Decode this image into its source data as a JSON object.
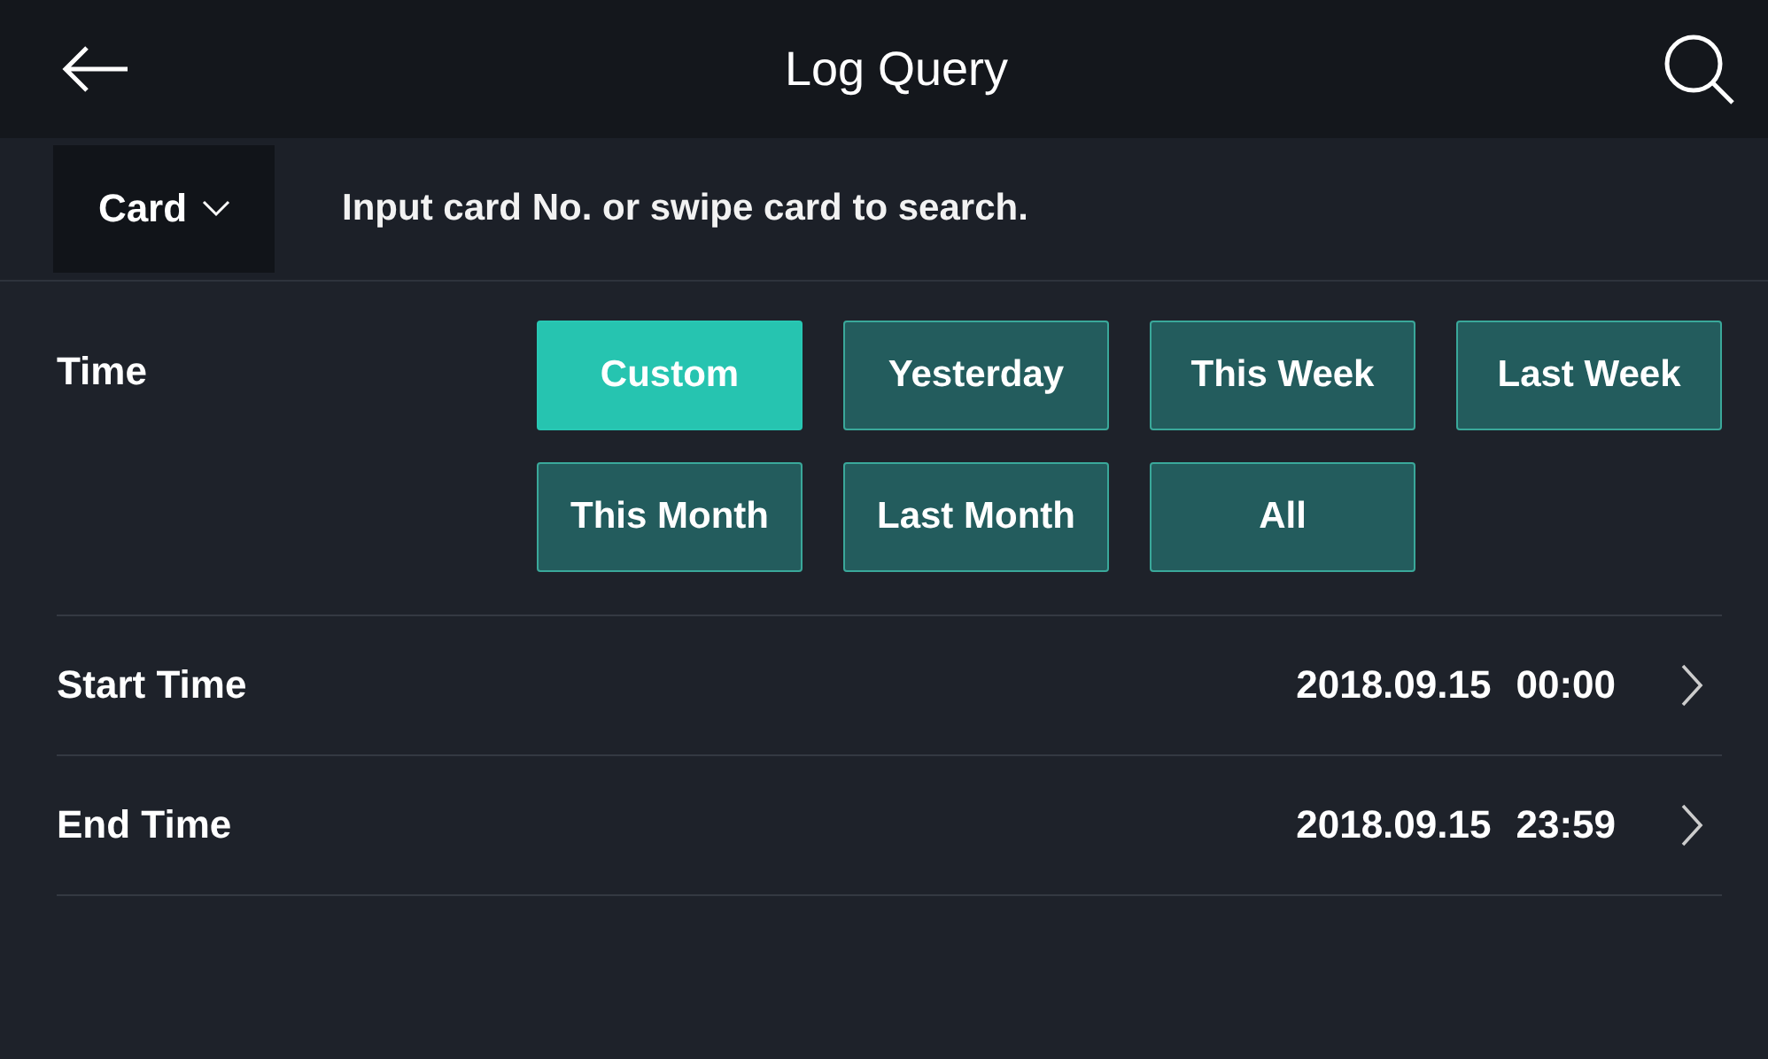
{
  "header": {
    "title": "Log Query"
  },
  "search": {
    "type_label": "Card",
    "placeholder": "Input card No. or swipe card to search."
  },
  "time": {
    "label": "Time",
    "options": [
      {
        "label": "Custom",
        "selected": true
      },
      {
        "label": "Yesterday",
        "selected": false
      },
      {
        "label": "This Week",
        "selected": false
      },
      {
        "label": "Last Week",
        "selected": false
      },
      {
        "label": "This Month",
        "selected": false
      },
      {
        "label": "Last Month",
        "selected": false
      },
      {
        "label": "All",
        "selected": false
      }
    ]
  },
  "rows": [
    {
      "label": "Start Time",
      "date": "2018.09.15",
      "time": "00:00"
    },
    {
      "label": "End Time",
      "date": "2018.09.15",
      "time": "23:59"
    }
  ]
}
